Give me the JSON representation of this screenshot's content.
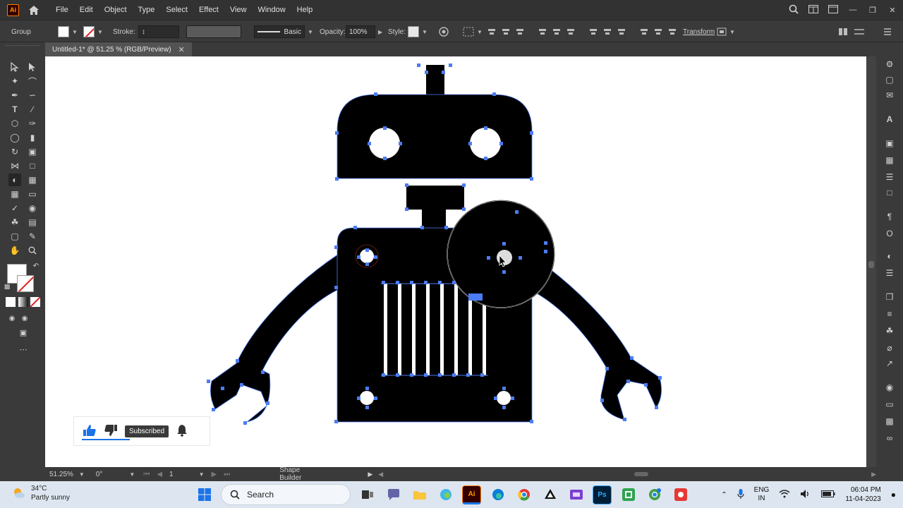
{
  "app": {
    "logo": "Ai"
  },
  "menu": {
    "items": [
      "File",
      "Edit",
      "Object",
      "Type",
      "Select",
      "Effect",
      "View",
      "Window",
      "Help"
    ]
  },
  "control_bar": {
    "selection": "Group",
    "stroke_label": "Stroke:",
    "stroke_style": "Basic",
    "opacity_label": "Opacity:",
    "opacity_value": "100%",
    "style_label": "Style:",
    "transform_label": "Transform"
  },
  "tab": {
    "title": "Untitled-1* @ 51.25 % (RGB/Preview)"
  },
  "status": {
    "zoom": "51.25%",
    "rotation": "0°",
    "artboard": "1",
    "tool_name": "Shape Builder"
  },
  "overlay": {
    "subscribed_label": "Subscribed"
  },
  "taskbar": {
    "weather_temp": "34°C",
    "weather_desc": "Partly sunny",
    "search_placeholder": "Search",
    "lang_line1": "ENG",
    "lang_line2": "IN",
    "time": "06:04 PM",
    "date": "11-04-2023"
  },
  "colors": {
    "accent": "#4c7cf3",
    "artwork": "#000000",
    "ai_brand": "#ff9a00"
  }
}
